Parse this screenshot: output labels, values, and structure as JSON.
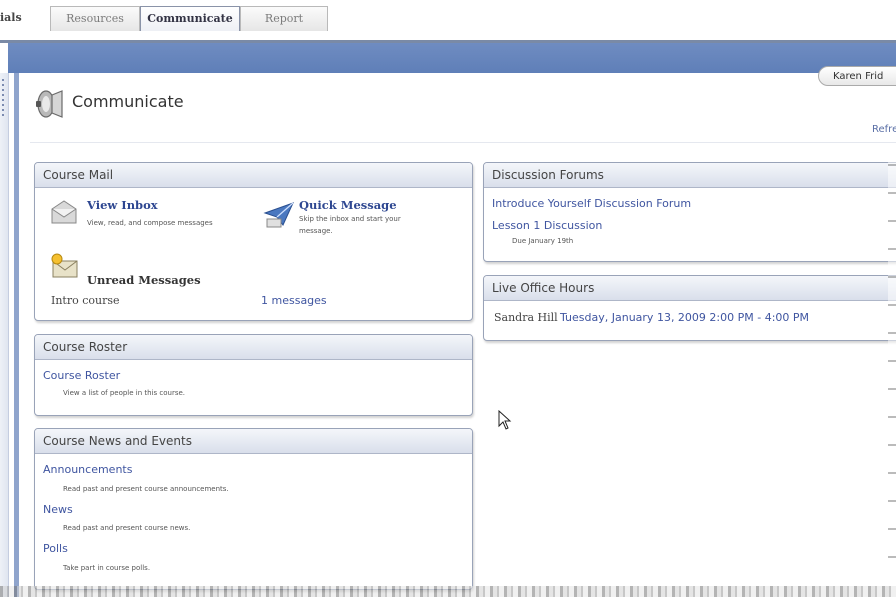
{
  "tabs": {
    "partial_label": "ials",
    "items": [
      "Resources",
      "Communicate",
      "Report"
    ],
    "active": "Communicate"
  },
  "user": {
    "name": "Karen Frid"
  },
  "page": {
    "title": "Communicate",
    "refresh_link": "Refre"
  },
  "course_mail": {
    "header": "Course Mail",
    "view_inbox": {
      "label": "View Inbox",
      "desc": "View, read, and compose messages"
    },
    "quick_message": {
      "label": "Quick Message",
      "desc1": "Skip the inbox and start your",
      "desc2": "message."
    },
    "unread": {
      "label": "Unread Messages",
      "course": "Intro course",
      "count_link": "1 messages"
    }
  },
  "course_roster": {
    "header": "Course Roster",
    "link": "Course Roster",
    "desc": "View a list of people in this course."
  },
  "news_events": {
    "header": "Course News and Events",
    "items": [
      {
        "label": "Announcements",
        "desc": "Read past and present course announcements."
      },
      {
        "label": "News",
        "desc": "Read past and present course news."
      },
      {
        "label": "Polls",
        "desc": "Take part in course polls."
      }
    ]
  },
  "discussion_forums": {
    "header": "Discussion Forums",
    "items": [
      {
        "label": "Introduce Yourself Discussion Forum",
        "due": ""
      },
      {
        "label": "Lesson 1 Discussion",
        "due": "Due January 19th"
      }
    ]
  },
  "office_hours": {
    "header": "Live Office Hours",
    "host": "Sandra Hill",
    "time_link": "Tuesday, January 13, 2009  2:00 PM - 4:00 PM"
  },
  "colors": {
    "accent": "#6f8cc1",
    "link": "#3f55a0",
    "panel_border": "#99a3b8"
  }
}
